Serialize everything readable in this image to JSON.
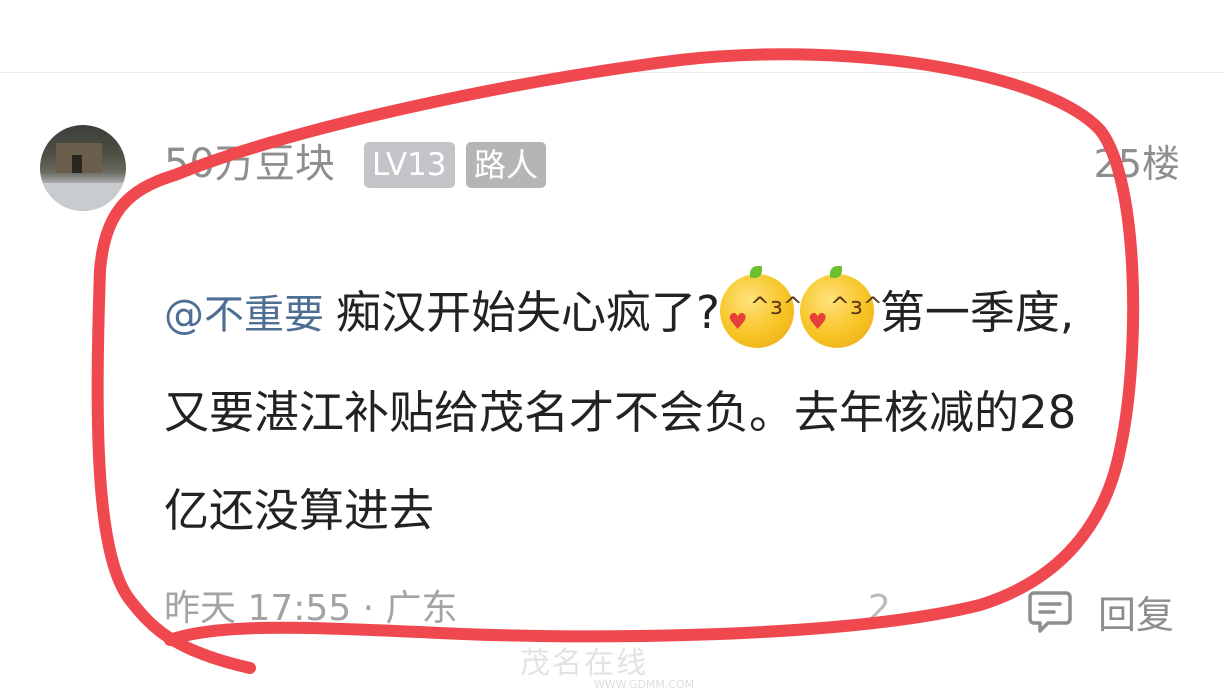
{
  "comment": {
    "username": "50万豆块",
    "level_badge": "LV13",
    "role_badge": "路人",
    "floor": "25楼",
    "mention": "@不重要",
    "text_part1": "痴汉开始失心疯了?",
    "text_part2": "第一季度,又要湛江补贴给茂名才不会负。去年核减的28亿还没算进去",
    "emojis": [
      "kiss-heart-orange-icon",
      "kiss-heart-orange-icon"
    ],
    "timestamp": "昨天 17:55 · 广东",
    "like_count": "2",
    "reply_label": "回复"
  },
  "annotation": {
    "color": "#f0484f"
  },
  "watermark": {
    "text": "茂名在线",
    "sub": "WWW.GDMM.COM"
  },
  "colors": {
    "mention": "#4e6f93",
    "body_text": "#222222",
    "meta": "#a3a3a3"
  }
}
